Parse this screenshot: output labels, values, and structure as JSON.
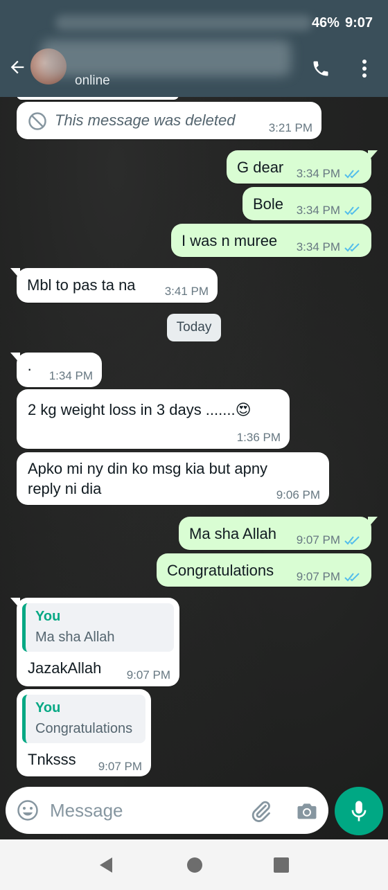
{
  "status_bar": {
    "battery": "46%",
    "time": "9:07"
  },
  "header": {
    "contact_status": "online",
    "colors": {
      "appbar": "#3a4f5a"
    }
  },
  "icons": {
    "back": "arrow-left-icon",
    "call": "phone-icon",
    "menu": "more-vertical-icon",
    "deleted": "block-icon",
    "emoji": "emoji-icon",
    "attach": "paperclip-icon",
    "camera": "camera-icon",
    "mic": "microphone-icon"
  },
  "messages": [
    {
      "direction": "in",
      "deleted": true,
      "text": "This message was deleted",
      "time": "3:21 PM"
    },
    {
      "direction": "out",
      "text": "G dear",
      "time": "3:34 PM",
      "read": true
    },
    {
      "direction": "out",
      "text": "Bole",
      "time": "3:34 PM",
      "read": true
    },
    {
      "direction": "out",
      "text": "I was n muree",
      "time": "3:34 PM",
      "read": true
    },
    {
      "direction": "in",
      "text": "Mbl to pas ta na",
      "time": "3:41 PM"
    },
    {
      "type": "date",
      "text": "Today"
    },
    {
      "direction": "in",
      "text": "·",
      "time": "1:34 PM"
    },
    {
      "direction": "in",
      "text": "2 kg weight loss in 3 days .......😍",
      "time": "1:36 PM"
    },
    {
      "direction": "in",
      "text_line1": "Apko mi ny din ko msg kia but apny",
      "text_line2": "reply ni dia",
      "time": "9:06 PM"
    },
    {
      "direction": "out",
      "text": "Ma sha Allah",
      "time": "9:07 PM",
      "read": true
    },
    {
      "direction": "out",
      "text": "Congratulations",
      "time": "9:07 PM",
      "read": true
    },
    {
      "direction": "in",
      "quote_author": "You",
      "quote_text": "Ma sha Allah",
      "text": "JazakAllah",
      "time": "9:07 PM"
    },
    {
      "direction": "in",
      "quote_author": "You",
      "quote_text": "Congratulations",
      "text": "Tnksss",
      "time": "9:07 PM"
    }
  ],
  "composer": {
    "placeholder": "Message"
  },
  "colors": {
    "outgoing_bubble": "#d9fdd3",
    "incoming_bubble": "#ffffff",
    "accent": "#00a884",
    "read_ticks": "#53bdeb"
  }
}
